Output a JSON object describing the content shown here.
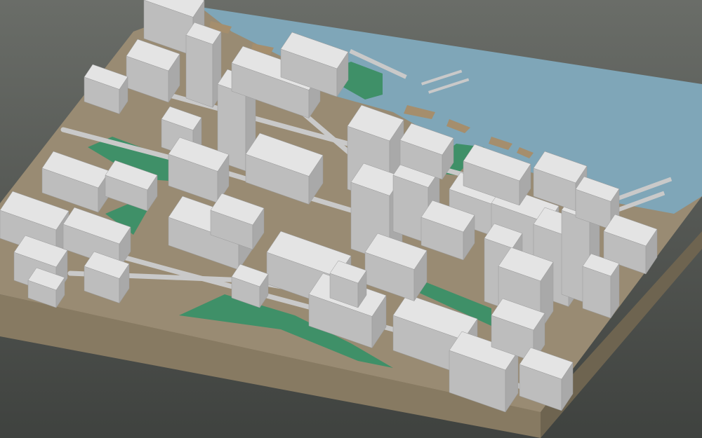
{
  "scene": {
    "description_name": "3d-city-block-model",
    "colors": {
      "background_top": "#6a6d68",
      "background_bottom": "#3f423f",
      "water": "#7fa6b8",
      "ground": "#998b73",
      "base_side": "#877a62",
      "base_side_dark": "#6e6450",
      "park": "#3f9068",
      "road": "#c9c9c9",
      "building_top": "#e4e4e4",
      "building_left": "#bdbdbd",
      "building_right": "#a9a9a9",
      "shoreline": "#a58e6d"
    }
  }
}
